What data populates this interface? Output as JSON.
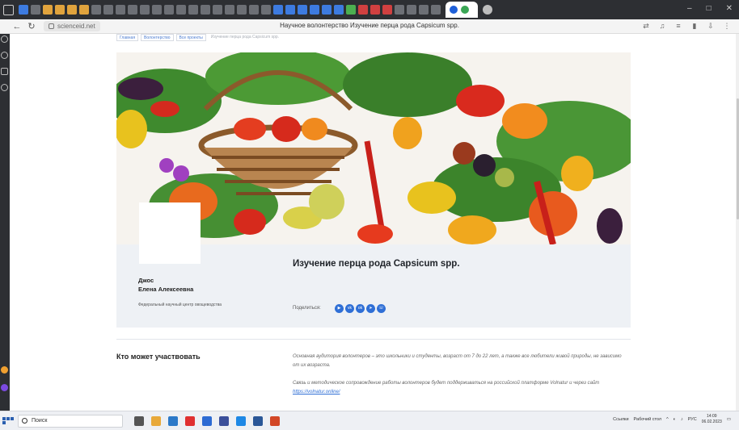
{
  "browser": {
    "url": "scienceid.net",
    "page_title": "Научное волонтерство Изучение перца рода Capsicum spp."
  },
  "breadcrumb": [
    {
      "label": "Главная"
    },
    {
      "label": "Волонтерство"
    },
    {
      "label": "Все проекты"
    },
    {
      "label": "Изучение перца рода Capsicum spp."
    }
  ],
  "project": {
    "title": "Изучение перца рода Capsicum spp.",
    "author_surname": "Джос",
    "author_name": "Елена Алексеевна",
    "organization": "Федеральный научный центр овощеводства",
    "share_label": "Поделиться:",
    "share_icons": [
      "ok-icon",
      "vk-icon",
      "odnoklassniki-icon",
      "telegram-icon",
      "whatsapp-icon"
    ]
  },
  "who": {
    "heading": "Кто может участвовать",
    "paragraph1": "Основная аудитория волонтеров – это школьники и студенты, возраст от 7 до 22 лет, а также все любители живой природы, не зависимо от их возраста.",
    "paragraph2_prefix": "Связь и методическое сопровождение работы волонтеров будет поддерживаться на российской платформе Volnatur и через сайт",
    "paragraph2_link": "https://volnatur.online/"
  },
  "taskbar": {
    "search_label": "Поиск",
    "tray_links": "Ссылки",
    "tray_desktop": "Рабочий стол",
    "tray_lang": "РУС",
    "time": "14:09",
    "date": "06.02.2023"
  },
  "colors": {
    "accent": "#2f6fd6",
    "card_bg": "#eef1f5",
    "chrome_dark": "#2d2f33"
  }
}
